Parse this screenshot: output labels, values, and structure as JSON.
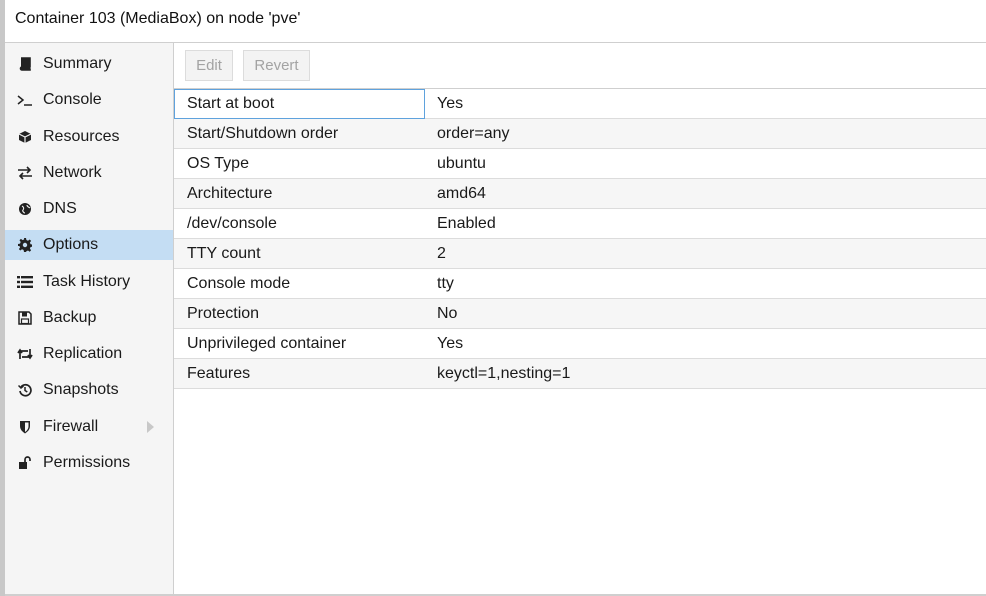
{
  "window": {
    "title": "Container 103 (MediaBox) on node 'pve'"
  },
  "sidebar": {
    "items": [
      {
        "label": "Summary",
        "icon": "book-icon"
      },
      {
        "label": "Console",
        "icon": "terminal-icon"
      },
      {
        "label": "Resources",
        "icon": "cube-icon"
      },
      {
        "label": "Network",
        "icon": "exchange-icon"
      },
      {
        "label": "DNS",
        "icon": "globe-icon"
      },
      {
        "label": "Options",
        "icon": "gear-icon",
        "selected": true
      },
      {
        "label": "Task History",
        "icon": "list-icon"
      },
      {
        "label": "Backup",
        "icon": "floppy-icon"
      },
      {
        "label": "Replication",
        "icon": "retweet-icon"
      },
      {
        "label": "Snapshots",
        "icon": "history-icon"
      },
      {
        "label": "Firewall",
        "icon": "shield-icon",
        "expandable": true
      },
      {
        "label": "Permissions",
        "icon": "unlock-icon"
      }
    ]
  },
  "toolbar": {
    "edit_label": "Edit",
    "revert_label": "Revert"
  },
  "options": {
    "rows": [
      {
        "key": "Start at boot",
        "value": "Yes"
      },
      {
        "key": "Start/Shutdown order",
        "value": "order=any"
      },
      {
        "key": "OS Type",
        "value": "ubuntu"
      },
      {
        "key": "Architecture",
        "value": "amd64"
      },
      {
        "key": "/dev/console",
        "value": "Enabled"
      },
      {
        "key": "TTY count",
        "value": "2"
      },
      {
        "key": "Console mode",
        "value": "tty"
      },
      {
        "key": "Protection",
        "value": "No"
      },
      {
        "key": "Unprivileged container",
        "value": "Yes"
      },
      {
        "key": "Features",
        "value": "keyctl=1,nesting=1"
      }
    ]
  },
  "colors": {
    "selected_nav": "#c4ddf3",
    "focus_border": "#5fa2dd",
    "alt_row": "#f6f6f6"
  }
}
